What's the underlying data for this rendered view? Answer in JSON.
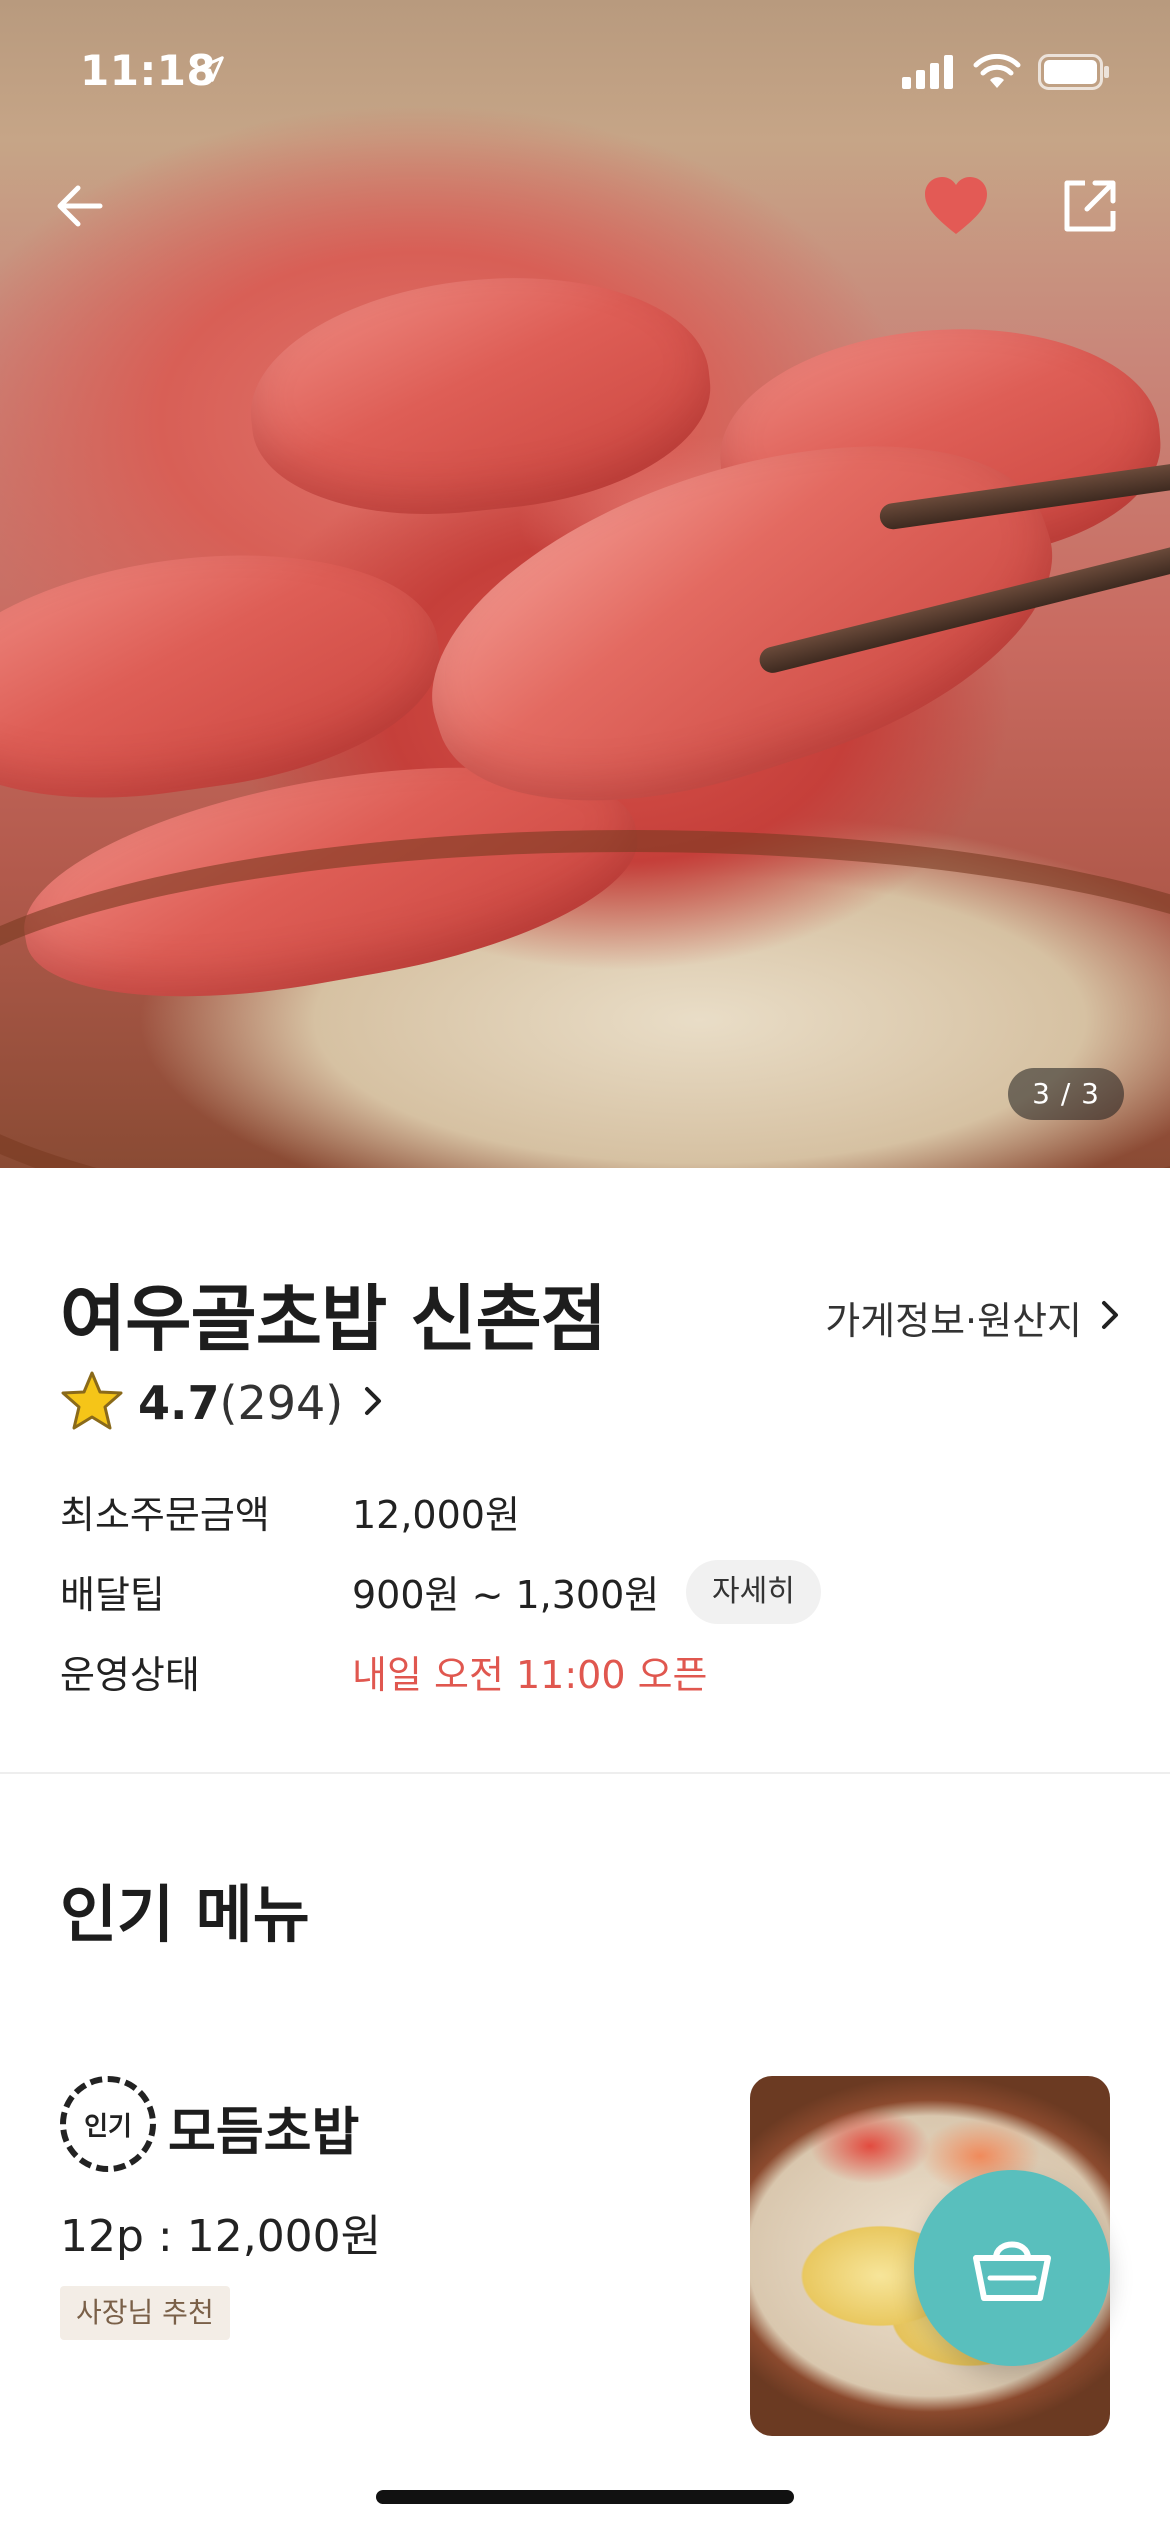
{
  "status_bar": {
    "time": "11:18"
  },
  "hero": {
    "image_counter": "3 / 3"
  },
  "store": {
    "name": "여우골초밥 신촌점",
    "info_link_label": "가게정보·원산지",
    "rating": {
      "score": "4.7",
      "count": "(294)"
    },
    "rows": [
      {
        "label": "최소주문금액",
        "value": "12,000원"
      },
      {
        "label": "배달팁",
        "value": "900원 ~ 1,300원",
        "action": "자세히"
      },
      {
        "label": "운영상태",
        "value": "내일 오전 11:00 오픈"
      }
    ]
  },
  "popular_menu": {
    "section_title": "인기 메뉴",
    "items": [
      {
        "badge": "인기",
        "name": "모듬초밥",
        "price": "12p : 12,000원",
        "tag": "사장님 추천"
      }
    ]
  },
  "colors": {
    "favorite_heart": "#e35a55",
    "status_open": "#e0574f",
    "cart_fab": "#59bfbd",
    "owner_tag_bg": "#f3ede6"
  },
  "icons": [
    "location-arrow-icon",
    "cellular-icon",
    "wifi-icon",
    "battery-icon",
    "back-arrow-icon",
    "heart-icon",
    "share-icon",
    "chevron-right-icon",
    "star-icon",
    "basket-icon"
  ]
}
